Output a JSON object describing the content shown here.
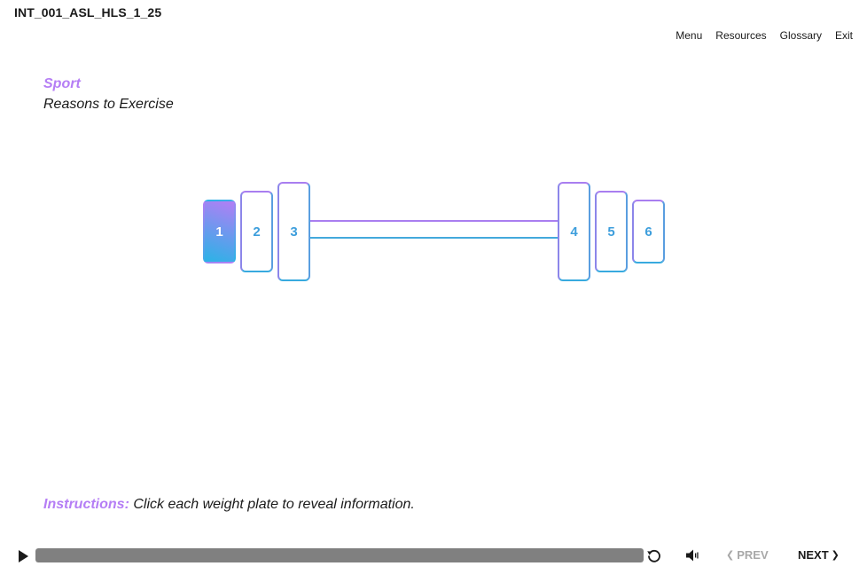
{
  "header": {
    "course_id": "INT_001_ASL_HLS_1_25"
  },
  "nav": {
    "menu": "Menu",
    "resources": "Resources",
    "glossary": "Glossary",
    "exit": "Exit"
  },
  "slide": {
    "subject": "Sport",
    "title": "Reasons to Exercise"
  },
  "plates": [
    {
      "label": "1",
      "state": "active"
    },
    {
      "label": "2",
      "state": "unvisited"
    },
    {
      "label": "3",
      "state": "unvisited"
    },
    {
      "label": "4",
      "state": "unvisited"
    },
    {
      "label": "5",
      "state": "unvisited"
    },
    {
      "label": "6",
      "state": "unvisited"
    }
  ],
  "instructions": {
    "label": "Instructions:",
    "text": " Click each weight plate to reveal information."
  },
  "player": {
    "progress_percent": 100,
    "prev_label": "PREV",
    "next_label": "NEXT",
    "icons": [
      "play-icon",
      "replay-icon",
      "volume-icon",
      "chevron-left-icon",
      "chevron-right-icon"
    ]
  },
  "colors": {
    "accent_purple": "#b57ef5",
    "accent_blue": "#3d9edc",
    "progress_fill": "#808080",
    "disabled": "#a8a8a8"
  }
}
